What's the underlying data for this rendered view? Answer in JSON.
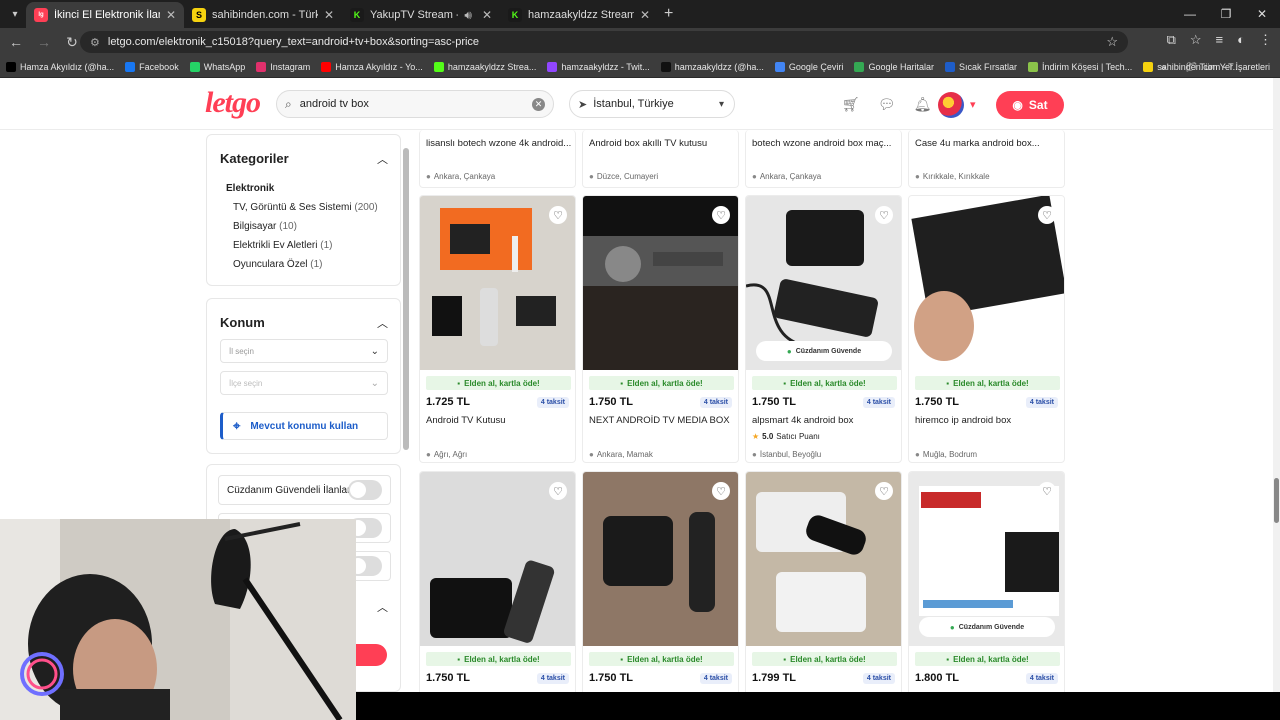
{
  "browser": {
    "tabs": [
      {
        "title": "İkinci El Elektronik İlanları ve Fiy",
        "active": true,
        "fav_color": "#ff3f55",
        "fav_text": "letgo"
      },
      {
        "title": "sahibinden.com - Türkiye'nin Or",
        "active": false,
        "fav_color": "#f5d20f",
        "fav_text": "S"
      },
      {
        "title": "YakupTV Stream - Watch Li",
        "active": false,
        "fav_color": "#53fc18",
        "fav_text": "K"
      },
      {
        "title": "hamzaakyldzz Stream - Watch",
        "active": false,
        "fav_color": "#53fc18",
        "fav_text": "K"
      }
    ],
    "url": "letgo.com/elektronik_c15018?query_text=android+tv+box&sorting=asc-price",
    "bookmarks": [
      {
        "label": "Hamza Akyıldız (@ha...",
        "icon": "x-icon",
        "color": "#000000"
      },
      {
        "label": "Facebook",
        "icon": "facebook-icon",
        "color": "#1877f2"
      },
      {
        "label": "WhatsApp",
        "icon": "whatsapp-icon",
        "color": "#25d366"
      },
      {
        "label": "Instagram",
        "icon": "instagram-icon",
        "color": "#e1306c"
      },
      {
        "label": "Hamza Akyıldız - Yo...",
        "icon": "youtube-icon",
        "color": "#ff0000"
      },
      {
        "label": "hamzaakyldzz Strea...",
        "icon": "kick-icon",
        "color": "#53fc18"
      },
      {
        "label": "hamzaakyldzz - Twit...",
        "icon": "twitch-icon",
        "color": "#9146ff"
      },
      {
        "label": "hamzaakyldzz (@ha...",
        "icon": "tiktok-icon",
        "color": "#111111"
      },
      {
        "label": "Google Çeviri",
        "icon": "translate-icon",
        "color": "#4285f4"
      },
      {
        "label": "Google Haritalar",
        "icon": "maps-icon",
        "color": "#34a853"
      },
      {
        "label": "Sıcak Fırsatlar",
        "icon": "t-icon",
        "color": "#1e5dc9"
      },
      {
        "label": "İndirim Köşesi | Tech...",
        "icon": "discount-icon",
        "color": "#8bc34a"
      },
      {
        "label": "sahibinden.com - T...",
        "icon": "sahibinden-icon",
        "color": "#f5d20f"
      }
    ],
    "all_bookmarks": "Tüm Yer İşaretleri"
  },
  "header": {
    "logo": "letgo",
    "search_value": "android tv box",
    "location": "İstanbul, Türkiye",
    "sell_label": "Sat",
    "brand_color": "#ff3f55"
  },
  "sidebar": {
    "categories_title": "Kategoriler",
    "root": "Elektronik",
    "items": [
      {
        "label": "TV, Görüntü & Ses Sistemi",
        "count": "(200)"
      },
      {
        "label": "Bilgisayar",
        "count": "(10)"
      },
      {
        "label": "Elektrikli Ev Aletleri",
        "count": "(1)"
      },
      {
        "label": "Oyunculara Özel",
        "count": "(1)"
      }
    ],
    "location_title": "Konum",
    "province_placeholder": "İl seçin",
    "district_placeholder": "İlçe seçin",
    "use_location": "Mevcut konumu kullan",
    "wallet_filter": "Cüzdanım Güvendeli İlanlar"
  },
  "listings_top_row": [
    {
      "title": "lisanslı botech wzone 4k android...",
      "location": "Ankara, Çankaya"
    },
    {
      "title": "Android box akıllı TV kutusu",
      "location": "Düzce, Cumayeri"
    },
    {
      "title": "botech wzone android box maç...",
      "location": "Ankara, Çankaya"
    },
    {
      "title": "Case 4u marka android box...",
      "location": "Kırıkkale, Kırıkkale"
    }
  ],
  "common": {
    "pay_strip": "Elden al, kartla öde!",
    "installment": "4 taksit",
    "wallet_badge": "Cüzdanım Güvende"
  },
  "listings": [
    {
      "price": "1.725 TL",
      "title": "Android TV Kutusu",
      "location": "Ağrı, Ağrı",
      "wallet": false,
      "rating": null
    },
    {
      "price": "1.750 TL",
      "title": "NEXT ANDROİD TV MEDIA BOX",
      "location": "Ankara, Mamak",
      "wallet": false,
      "rating": null
    },
    {
      "price": "1.750 TL",
      "title": "alpsmart 4k android box",
      "location": "İstanbul, Beyoğlu",
      "wallet": true,
      "rating": "5.0",
      "rating_label": "Satıcı Puanı"
    },
    {
      "price": "1.750 TL",
      "title": "hiremco ip android box",
      "location": "Muğla, Bodrum",
      "wallet": false,
      "rating": null
    },
    {
      "price": "1.750 TL",
      "title": "",
      "location": "",
      "wallet": false,
      "rating": null
    },
    {
      "price": "1.750 TL",
      "title": "",
      "location": "",
      "wallet": false,
      "rating": null
    },
    {
      "price": "1.799 TL",
      "title": "",
      "location": "",
      "wallet": false,
      "rating": null
    },
    {
      "price": "1.800 TL",
      "title": "",
      "location": "",
      "wallet": true,
      "rating": null
    }
  ]
}
